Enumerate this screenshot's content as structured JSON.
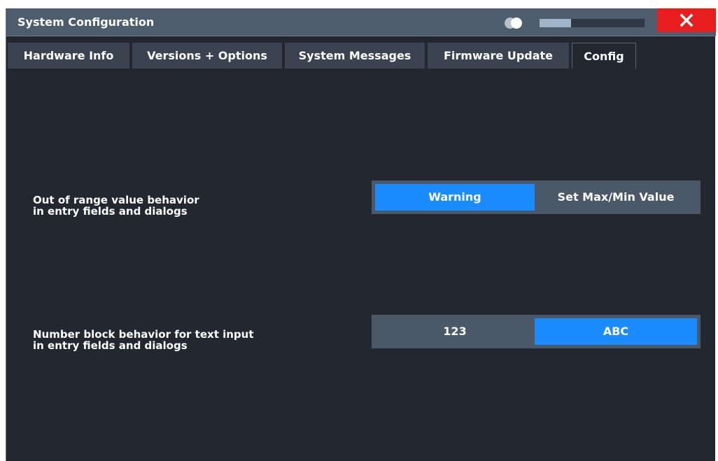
{
  "window": {
    "title": "System Configuration",
    "progress_fraction": 0.3,
    "close_label": "✕"
  },
  "tabs": [
    {
      "label": "Hardware Info",
      "active": false
    },
    {
      "label": "Versions + Options",
      "active": false
    },
    {
      "label": "System Messages",
      "active": false
    },
    {
      "label": "Firmware Update",
      "active": false
    },
    {
      "label": "Config",
      "active": true
    }
  ],
  "settings": [
    {
      "label_line1": "Out of range value behavior",
      "label_line2": "in entry fields and dialogs",
      "options": [
        {
          "label": "Warning",
          "selected": true
        },
        {
          "label": "Set Max/Min Value",
          "selected": false
        }
      ]
    },
    {
      "label_line1": "Number block behavior for text input",
      "label_line2": "in entry fields and dialogs",
      "options": [
        {
          "label": "123",
          "selected": false
        },
        {
          "label": "ABC",
          "selected": true
        }
      ]
    }
  ],
  "colors": {
    "accent": "#1a8cff",
    "close": "#e81d1d",
    "background": "#23272f",
    "titlebar": "#4e5d6e"
  }
}
